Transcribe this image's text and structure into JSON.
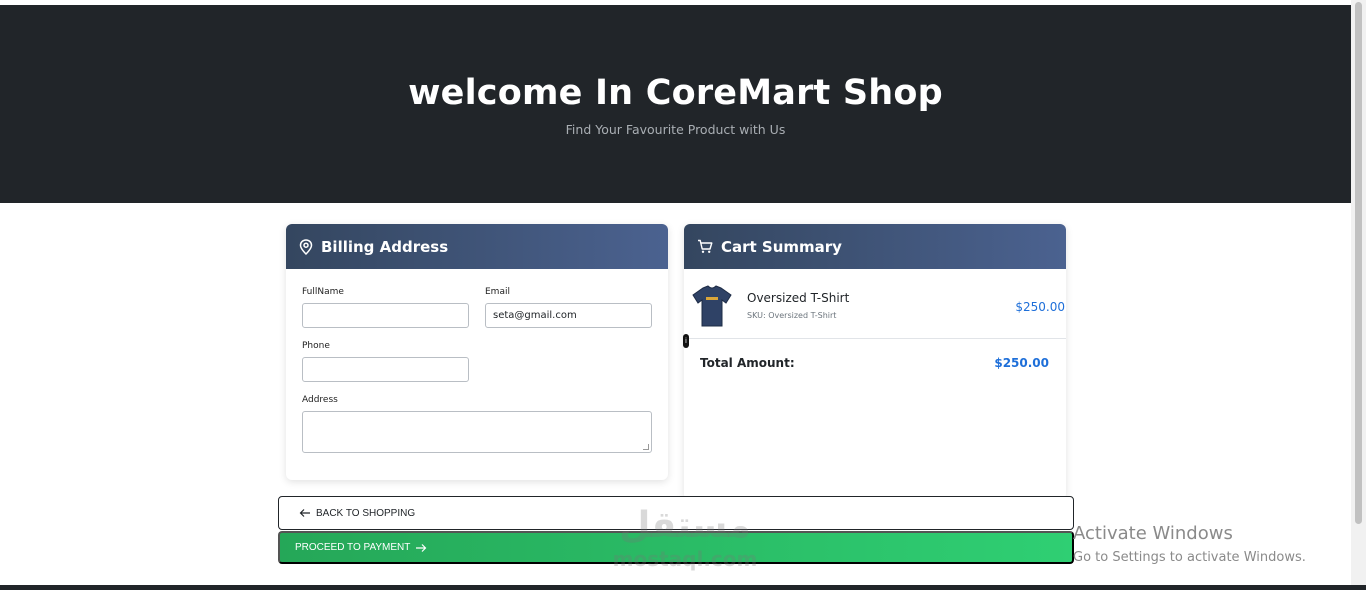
{
  "hero": {
    "title": "welcome In CoreMart Shop",
    "subtitle": "Find Your Favourite Product with Us"
  },
  "billing": {
    "title": "Billing Address",
    "fullname_label": "FullName",
    "fullname_value": "",
    "email_label": "Email",
    "email_value": "seta@gmail.com",
    "phone_label": "Phone",
    "phone_value": "",
    "address_label": "Address",
    "address_value": ""
  },
  "cart": {
    "title": "Cart Summary",
    "items": [
      {
        "name": "Oversized T-Shirt",
        "sku": "SKU: Oversized T-Shirt",
        "price": "$250.00"
      }
    ],
    "total_label": "Total Amount:",
    "total_value": "$250.00"
  },
  "actions": {
    "back_label": "BACK TO SHOPPING",
    "pay_label": "PROCEED TO PAYMENT"
  },
  "overlay": {
    "watermark_arabic": "مستقل",
    "watermark_latin": "mostaql.com",
    "activate_title": "Activate Windows",
    "activate_subtitle": "Go to Settings to activate Windows."
  },
  "colors": {
    "hero_bg": "#212529",
    "card_header": "#3f5478",
    "price_blue": "#1e6fd9",
    "pay_green": "#2bbd66"
  }
}
